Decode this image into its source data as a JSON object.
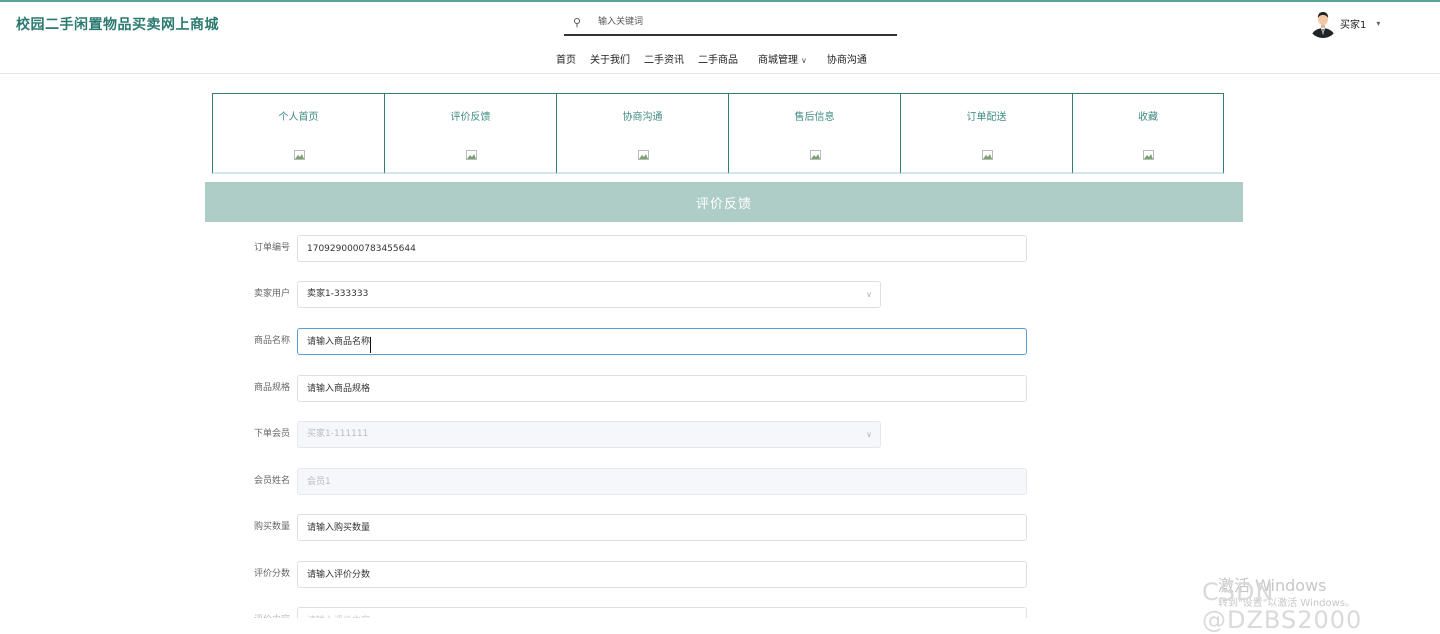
{
  "header": {
    "site_title": "校园二手闲置物品买卖网上商城",
    "search_placeholder": "输入关键词",
    "user_name": "买家1"
  },
  "nav": {
    "items": [
      "首页",
      "关于我们",
      "二手资讯",
      "二手商品",
      "商城管理",
      "协商沟通"
    ]
  },
  "tabs": [
    {
      "label": "个人首页"
    },
    {
      "label": "评价反馈"
    },
    {
      "label": "协商沟通"
    },
    {
      "label": "售后信息"
    },
    {
      "label": "订单配送"
    },
    {
      "label": "收藏"
    }
  ],
  "section": {
    "title": "评价反馈"
  },
  "form": {
    "order_no": {
      "label": "订单编号",
      "value": "1709290000783455644"
    },
    "seller": {
      "label": "卖家用户",
      "value": "卖家1-333333"
    },
    "product_name": {
      "label": "商品名称",
      "placeholder": "请输入商品名称"
    },
    "product_spec": {
      "label": "商品规格",
      "placeholder": "请输入商品规格"
    },
    "member": {
      "label": "下单会员",
      "value": "买家1-111111"
    },
    "member_name": {
      "label": "会员姓名",
      "placeholder": "会员1"
    },
    "quantity": {
      "label": "购买数量",
      "placeholder": "请输入购买数量"
    },
    "score": {
      "label": "评价分数",
      "placeholder": "请输入评价分数"
    },
    "content": {
      "label": "评价内容",
      "placeholder": "请输入评价内容"
    }
  },
  "watermark": {
    "activate_title": "激活 Windows",
    "activate_sub": "转到\"设置\"以激活 Windows。",
    "csdn": "CSDN @DZBS2000"
  }
}
